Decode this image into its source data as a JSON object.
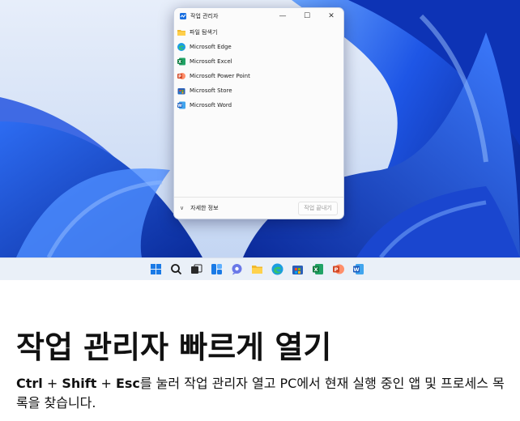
{
  "task_manager": {
    "title": "작업 관리자",
    "controls": {
      "minimize": "—",
      "maximize": "☐",
      "close": "✕"
    },
    "apps": [
      {
        "label": "파일 탐색기",
        "icon": "folder-icon",
        "color": "#f1b92d"
      },
      {
        "label": "Microsoft Edge",
        "icon": "edge-icon",
        "color": "#1b9de2"
      },
      {
        "label": "Microsoft Excel",
        "icon": "excel-icon",
        "color": "#1d7a45"
      },
      {
        "label": "Microsoft Power Point",
        "icon": "powerpoint-icon",
        "color": "#d24726"
      },
      {
        "label": "Microsoft Store",
        "icon": "store-icon",
        "color": "#2b5fb8"
      },
      {
        "label": "Microsoft Word",
        "icon": "word-icon",
        "color": "#2b5fb8"
      }
    ],
    "more_details": "자세한 정보",
    "more_chevron": "∨",
    "end_task": "작업 끝내기"
  },
  "taskbar": {
    "icons": [
      "start-icon",
      "search-icon",
      "task-view-icon",
      "widgets-icon",
      "chat-icon",
      "file-explorer-icon",
      "edge-icon",
      "store-icon",
      "excel-icon",
      "powerpoint-icon",
      "word-icon"
    ]
  },
  "caption": {
    "headline": "작업 관리자 빠르게 열기",
    "key_ctrl": "Ctrl",
    "plus1": " + ",
    "key_shift": "Shift",
    "plus2": " + ",
    "key_esc": "Esc",
    "rest": "를 눌러 작업 관리자 열고 PC에서 현재 실행 중인 앱 및 프로세스 목록을 찾습니다."
  },
  "colors": {
    "accent": "#1a55e0",
    "wallpaper_light": "#c9dcf6",
    "wallpaper_deep": "#0a2ea8"
  }
}
